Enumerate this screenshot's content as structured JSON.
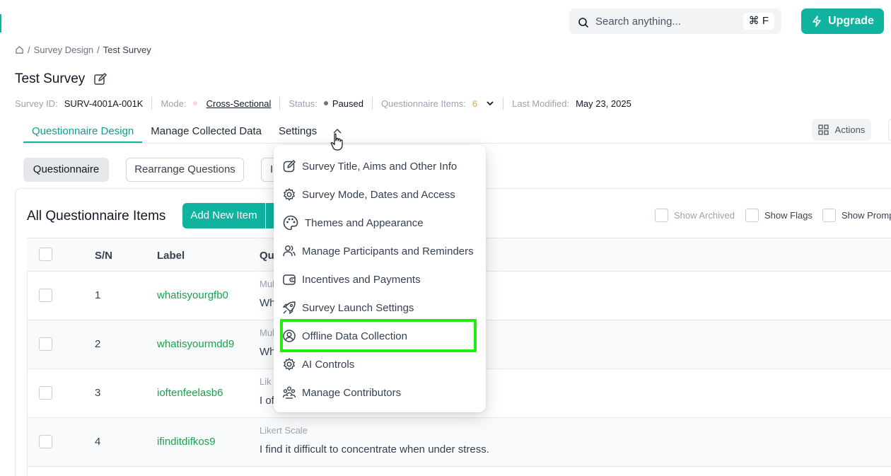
{
  "search": {
    "placeholder": "Search anything...",
    "shortcut": "⌘ F"
  },
  "upgrade_label": "Upgrade",
  "breadcrumb": {
    "parent": "Survey Design",
    "separator": "/",
    "current": "Test Survey"
  },
  "survey": {
    "title": "Test Survey",
    "id_label": "Survey ID:",
    "id_value": "SURV-4001A-001K",
    "mode_label": "Mode:",
    "mode_value": "Cross-Sectional",
    "status_label": "Status:",
    "status_value": "Paused",
    "items_label": "Questionnaire Items:",
    "items_count": "6",
    "modified_label": "Last Modified:",
    "modified_value": "May 23, 2025"
  },
  "tabs": [
    {
      "label": "Questionnaire Design",
      "active": true
    },
    {
      "label": "Manage Collected Data",
      "active": false
    },
    {
      "label": "Settings",
      "active": false
    }
  ],
  "actions_label": "Actions",
  "subnav": {
    "questionnaire": "Questionnaire",
    "rearrange": "Rearrange Questions",
    "third": "I"
  },
  "card": {
    "title": "All Questionnaire Items",
    "add_label": "Add New Item",
    "show_archived": "Show Archived",
    "show_flags": "Show Flags",
    "show_prompts": "Show Promp"
  },
  "table": {
    "headers": {
      "sn": "S/N",
      "label": "Label",
      "question": "Qu"
    },
    "rows": [
      {
        "sn": "1",
        "label": "whatisyourgfb0",
        "type": "Mul",
        "text": "Wh"
      },
      {
        "sn": "2",
        "label": "whatisyourmdd9",
        "type": "Mul",
        "text": "Wh"
      },
      {
        "sn": "3",
        "label": "ioftenfeelasb6",
        "type": "Lik",
        "text": "I of"
      },
      {
        "sn": "4",
        "label": "ifinditdifkos9",
        "type": "Likert Scale",
        "text": "I find it difficult to concentrate when under stress."
      }
    ],
    "row3_tail": "."
  },
  "settings_menu": [
    {
      "label": "Survey Title, Aims and Other Info",
      "icon": "edit-icon"
    },
    {
      "label": "Survey Mode, Dates and Access",
      "icon": "gear-icon"
    },
    {
      "label": "Themes and Appearance",
      "icon": "palette-icon"
    },
    {
      "label": "Manage Participants and Reminders",
      "icon": "users-icon"
    },
    {
      "label": "Incentives and Payments",
      "icon": "wallet-icon"
    },
    {
      "label": "Survey Launch Settings",
      "icon": "rocket-icon"
    },
    {
      "label": "Offline Data Collection",
      "icon": "user-circle-icon",
      "highlighted": true
    },
    {
      "label": "AI Controls",
      "icon": "gear-icon"
    },
    {
      "label": "Manage Contributors",
      "icon": "team-icon"
    }
  ],
  "colors": {
    "accent": "#10b3a0",
    "highlight": "#22ee11",
    "label_green": "#16a34a",
    "count_orange": "#f0a81c"
  }
}
